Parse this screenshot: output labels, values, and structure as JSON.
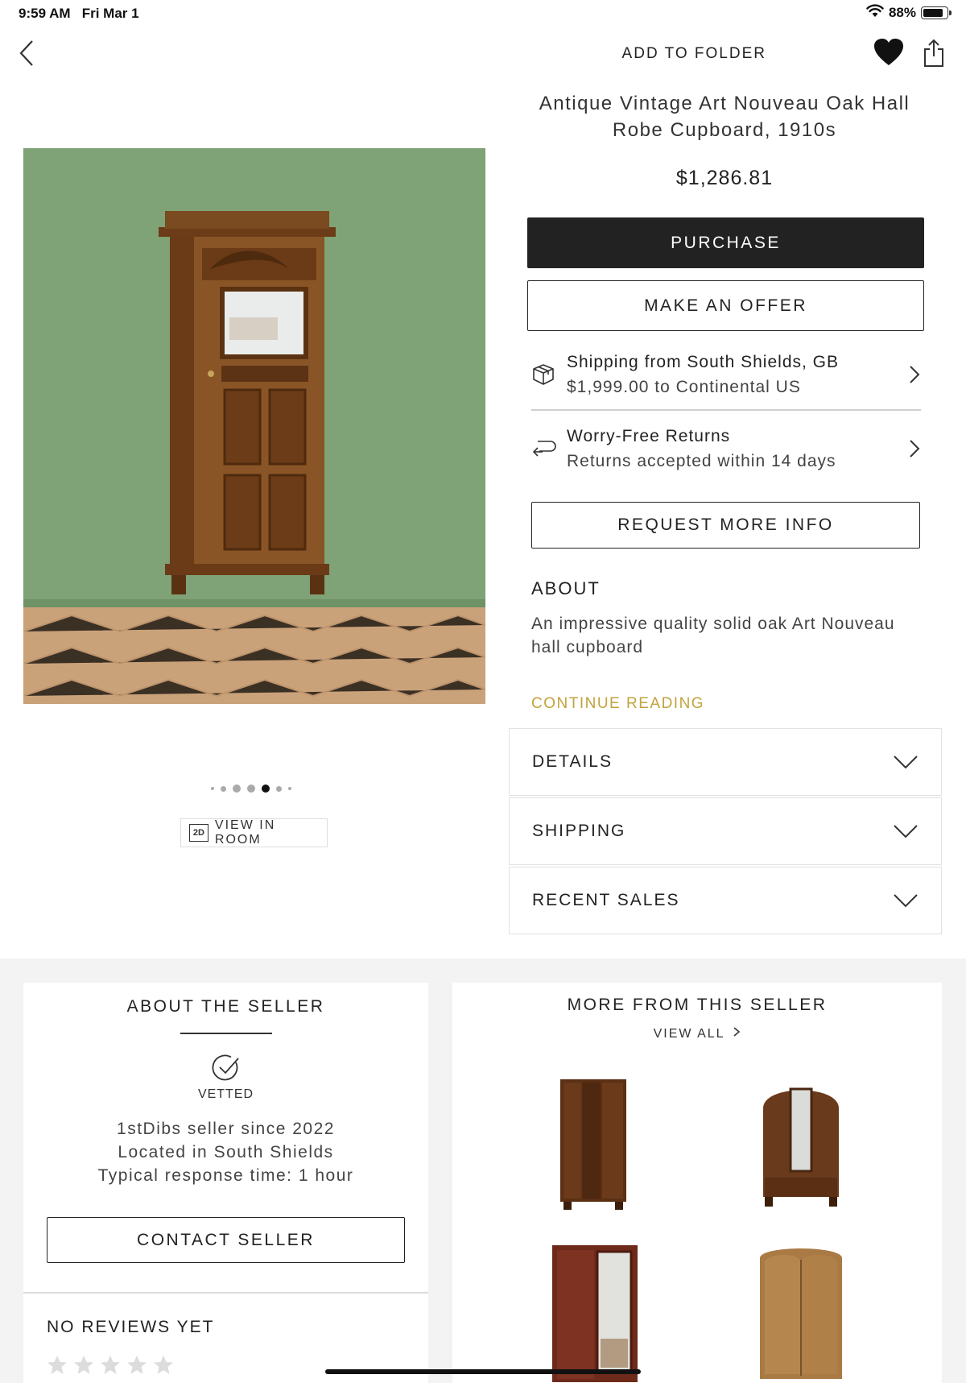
{
  "status_bar": {
    "time": "9:59 AM",
    "date": "Fri Mar 1",
    "battery": "88%",
    "battery_level": 0.88
  },
  "top_bar": {
    "add_to_folder": "ADD TO FOLDER"
  },
  "product": {
    "title_line1": "Antique Vintage Art Nouveau Oak Hall",
    "title_line2": "Robe Cupboard, 1910s",
    "price": "$1,286.81",
    "purchase_label": "PURCHASE",
    "offer_label": "MAKE AN OFFER"
  },
  "shipping_row": {
    "title": "Shipping from South Shields, GB",
    "sub": "$1,999.00 to Continental US"
  },
  "returns_row": {
    "title": "Worry-Free Returns",
    "sub": "Returns accepted within 14 days"
  },
  "request_info_label": "REQUEST MORE INFO",
  "about": {
    "heading": "ABOUT",
    "text": "An impressive quality solid oak Art Nouveau hall cupboard",
    "continue": "CONTINUE READING"
  },
  "accordions": {
    "details": "DETAILS",
    "shipping": "SHIPPING",
    "recent_sales": "RECENT SALES"
  },
  "gallery": {
    "image_count": 7,
    "active_index": 4,
    "view_in_room": "VIEW IN ROOM",
    "badge": "2D"
  },
  "seller": {
    "heading": "ABOUT THE SELLER",
    "vetted": "VETTED",
    "since": "1stDibs seller since 2022",
    "location": "Located in South Shields",
    "response": "Typical response time: 1 hour",
    "contact_label": "CONTACT SELLER",
    "reviews_heading": "NO REVIEWS YET",
    "star_count": 5
  },
  "more_from_seller": {
    "heading": "MORE FROM THIS SELLER",
    "view_all": "VIEW ALL"
  },
  "colors": {
    "accent_gold": "#c2a33c",
    "button_dark": "#222222",
    "wall_green": "#7fa276"
  }
}
